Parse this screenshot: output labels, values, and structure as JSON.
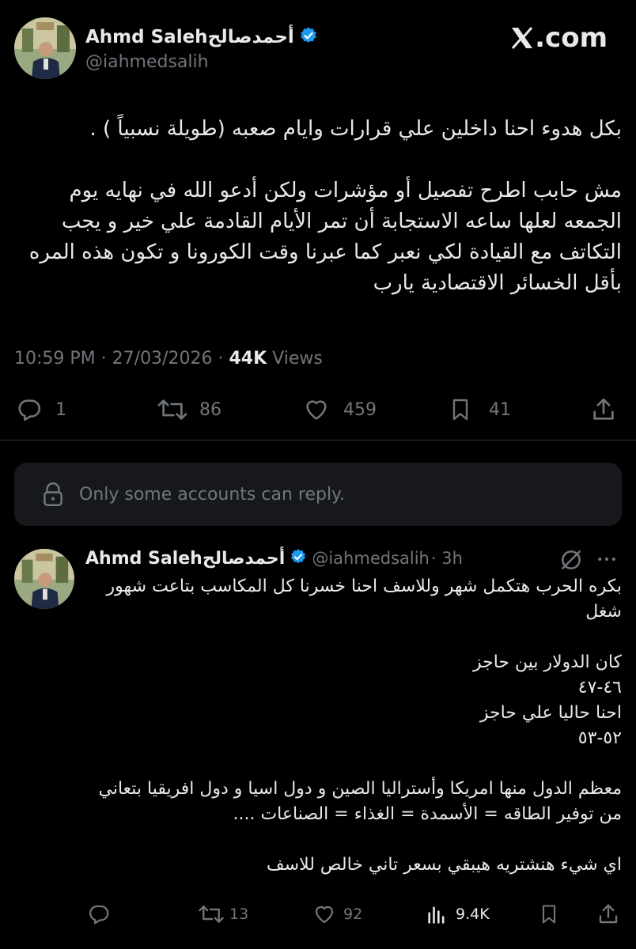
{
  "brand": {
    "site": ".com"
  },
  "tweet": {
    "author_name": "Ahmd Salehأحمدصالح",
    "author_handle": "@iahmedsalih",
    "paragraphs": [
      "بكل هدوء احنا داخلين علي قرارات وايام صعبه  (طويلة نسبياً ) .",
      "مش حابب اطرح تفصيل أو مؤشرات ولكن أدعو الله في نهايه يوم الجمعه لعلها ساعه الاستجابة أن تمر الأيام القادمة علي خير و يجب التكاتف مع القيادة لكي نعبر كما عبرنا وقت الكورونا و تكون هذه المره بأقل الخسائر الاقتصادية يارب"
    ],
    "time": "10:59 PM",
    "date": "27/03/2026",
    "separator": "·",
    "views_count": "44K",
    "views_label": "Views",
    "replies": "1",
    "reposts": "86",
    "likes": "459",
    "bookmarks": "41"
  },
  "reply_notice": "Only some accounts can reply.",
  "reply": {
    "author_name": "Ahmd Salehأحمدصالح",
    "author_handle": "@iahmedsalih",
    "time_ago": "· 3h",
    "lines": [
      "بكره الحرب هتكمل شهر وللاسف احنا خسرنا كل المكاسب بتاعت شهور شغل",
      "",
      "كان الدولار بين حاجز",
      "٤٦-٤٧",
      "احنا حاليا علي حاجز",
      "٥٢-٥٣",
      "",
      "معظم الدول منها  امريكا وأستراليا الصين  و دول اسيا و دول افريقيا بتعاني من توفير الطاقه = الأسمدة = الغذاء = الصناعات ....",
      "",
      "اي شيء هنشتريه هيبقي بسعر تاني خالص للاسف"
    ],
    "replies": "",
    "reposts": "13",
    "likes": "92",
    "views": "9.4K"
  },
  "colors": {
    "background": "#000000",
    "text": "#e7e9ea",
    "muted": "#71767b",
    "verified": "#1d9bf0",
    "divider": "#2f3336",
    "notice_bg": "#16181c"
  }
}
